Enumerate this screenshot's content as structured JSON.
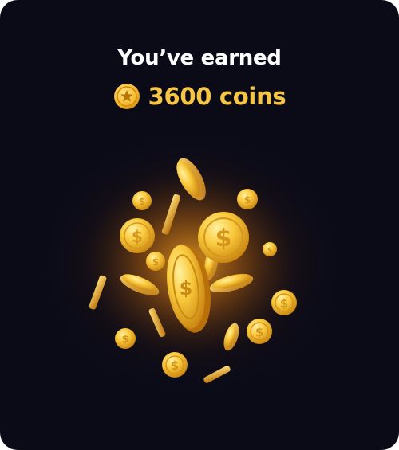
{
  "reward": {
    "headline": "You’ve earned",
    "amount_text": "3600 coins",
    "icon": "coin-star-icon",
    "illustration": "coin-burst-illustration",
    "colors": {
      "background": "#0b0b18",
      "headline": "#ffffff",
      "amount": "#f7c545",
      "glow": "#f5a623"
    }
  }
}
